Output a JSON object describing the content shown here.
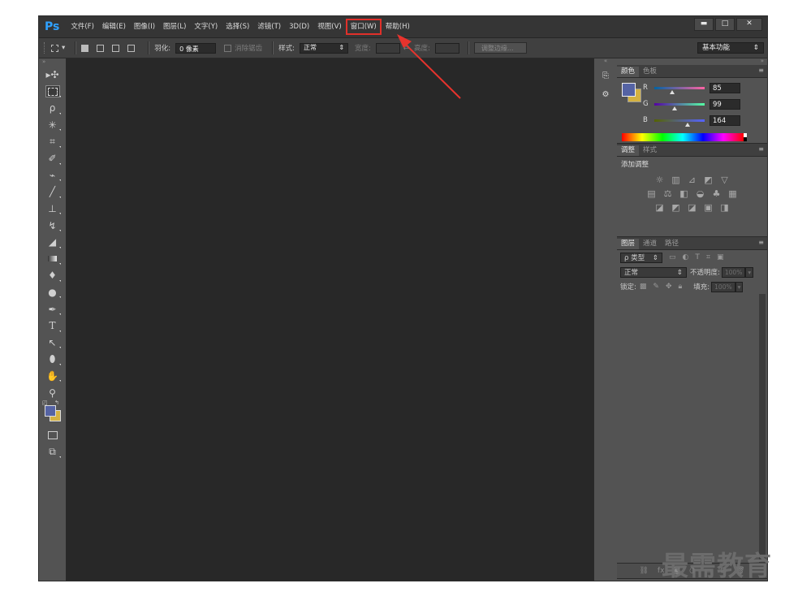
{
  "app": {
    "logo": "Ps",
    "menus": [
      "文件(F)",
      "编辑(E)",
      "图像(I)",
      "图层(L)",
      "文字(Y)",
      "选择(S)",
      "滤镜(T)",
      "3D(D)",
      "视图(V)",
      "窗口(W)",
      "帮助(H)"
    ],
    "highlighted_menu": "窗口(W)",
    "window_buttons": {
      "minimize": "▬",
      "maximize": "□",
      "close": "✕"
    }
  },
  "options": {
    "feather_label": "羽化:",
    "feather_value": "0 像素",
    "antialias_label": "消除锯齿",
    "style_label": "样式:",
    "style_value": "正常",
    "width_label": "宽度:",
    "height_label": "高度:",
    "refine_edge": "调整边缘...",
    "workspace": "基本功能"
  },
  "panels": {
    "color": {
      "tab_color": "颜色",
      "tab_swatches": "色板",
      "r_label": "R",
      "g_label": "G",
      "b_label": "B",
      "r": "85",
      "g": "99",
      "b": "164",
      "fg_color": "#5563a4",
      "bg_color": "#d4b241"
    },
    "adjust": {
      "tab_adjust": "调整",
      "tab_styles": "样式",
      "title": "添加调整"
    },
    "layers": {
      "tab_layers": "图层",
      "tab_channels": "通道",
      "tab_paths": "路径",
      "filter": "ρ 类型",
      "blend": "正常",
      "opacity_label": "不透明度:",
      "opacity_value": "100%",
      "lock_label": "锁定:",
      "fill_label": "填充:",
      "fill_value": "100%"
    }
  },
  "watermark": "最需教育"
}
